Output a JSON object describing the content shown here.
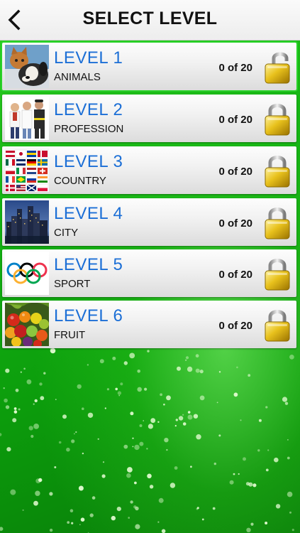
{
  "header": {
    "title": "SELECT LEVEL",
    "back_icon": "chevron-left-icon"
  },
  "levels": [
    {
      "title": "LEVEL 1",
      "category": "ANIMALS",
      "progress": "0 of 20",
      "completed": 0,
      "total": 20,
      "thumbnail": "animals",
      "unlocked": true
    },
    {
      "title": "LEVEL 2",
      "category": "PROFESSION",
      "progress": "0 of 20",
      "completed": 0,
      "total": 20,
      "thumbnail": "profession",
      "unlocked": false
    },
    {
      "title": "LEVEL 3",
      "category": "COUNTRY",
      "progress": "0 of 20",
      "completed": 0,
      "total": 20,
      "thumbnail": "country",
      "unlocked": false
    },
    {
      "title": "LEVEL 4",
      "category": "CITY",
      "progress": "0 of 20",
      "completed": 0,
      "total": 20,
      "thumbnail": "city",
      "unlocked": false
    },
    {
      "title": "LEVEL 5",
      "category": "SPORT",
      "progress": "0 of 20",
      "completed": 0,
      "total": 20,
      "thumbnail": "sport",
      "unlocked": false
    },
    {
      "title": "LEVEL 6",
      "category": "FRUIT",
      "progress": "0 of 20",
      "completed": 0,
      "total": 20,
      "thumbnail": "fruit",
      "unlocked": false
    }
  ],
  "colors": {
    "accent": "#1c6fd6",
    "background": "#13b313",
    "active_border": "#2ad22a"
  }
}
